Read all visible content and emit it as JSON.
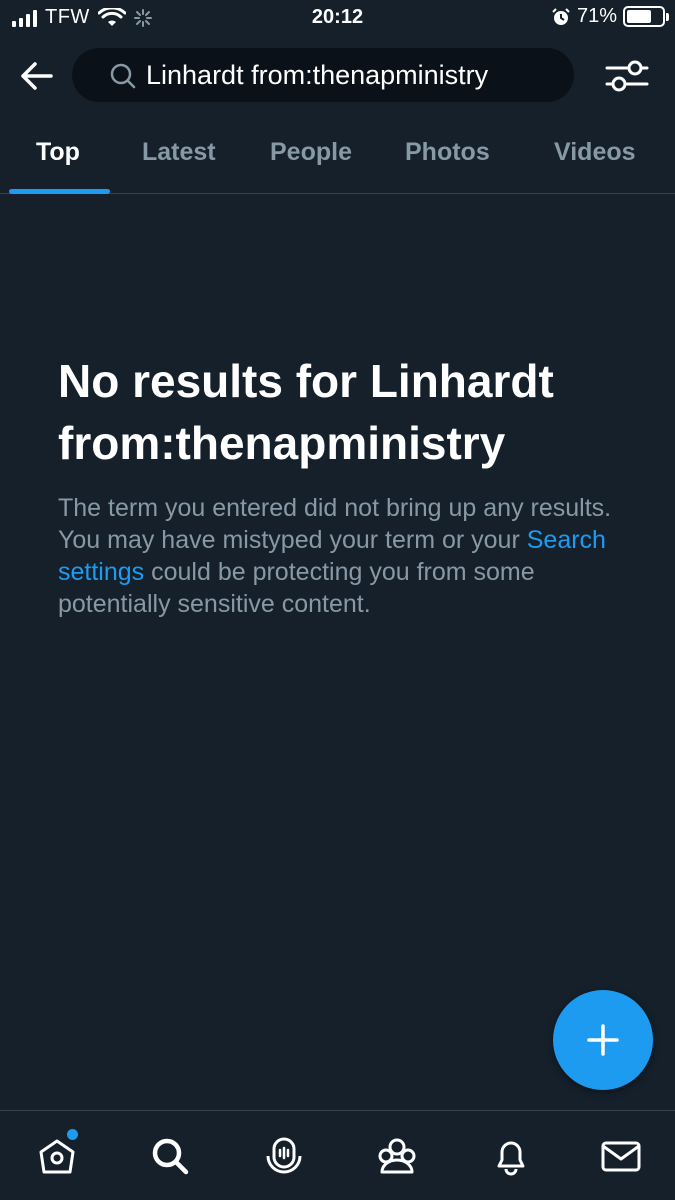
{
  "status_bar": {
    "carrier": "TFW",
    "time": "20:12",
    "battery_percent": "71%",
    "battery_level": 0.71
  },
  "search": {
    "query": "Linhardt from:thenapministry"
  },
  "tabs": [
    {
      "label": "Top",
      "active": true
    },
    {
      "label": "Latest",
      "active": false
    },
    {
      "label": "People",
      "active": false
    },
    {
      "label": "Photos",
      "active": false
    },
    {
      "label": "Videos",
      "active": false
    }
  ],
  "empty_state": {
    "title": "No results for Linhardt from:thenapministry",
    "body_before": "The term you entered did not bring up any results. You may have mistyped your term or your ",
    "link": "Search settings",
    "body_after": " could be protecting you from some potentially sensitive content."
  },
  "colors": {
    "background": "#15202b",
    "accent": "#1d9bf0",
    "secondary_text": "#8899a6"
  },
  "icons": {
    "back": "arrow-left-icon",
    "search": "search-icon",
    "filter": "sliders-icon",
    "compose": "plus-icon",
    "nav": [
      "home-icon",
      "search-icon",
      "spaces-icon",
      "communities-icon",
      "bell-icon",
      "mail-icon"
    ]
  }
}
